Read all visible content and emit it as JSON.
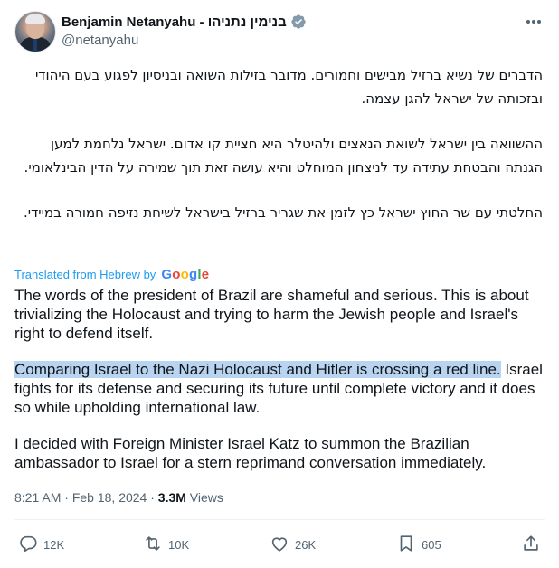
{
  "author": {
    "display_name": "Benjamin Netanyahu - בנימין נתניהו",
    "handle": "@netanyahu",
    "verified_icon": "verified-badge-icon",
    "avatar": "avatar"
  },
  "post": {
    "hebrew_paragraphs": [
      "הדברים של נשיא ברזיל מבישים וחמורים. מדובר בזילות השואה ובניסיון לפגוע בעם היהודי ובזכותה של ישראל להגן עצמה.",
      "ההשוואה בין ישראל לשואת הנאצים ולהיטלר היא חציית קו אדום. ישראל נלחמת למען הגנתה והבטחת עתידה עד לניצחון המוחלט והיא עושה זאת תוך שמירה על הדין הבינלאומי.",
      "החלטתי עם שר החוץ ישראל כץ לזמן את שגריר ברזיל בישראל לשיחת נזיפה חמורה במיידי."
    ],
    "translated_label": "Translated from Hebrew by",
    "translator": "Google",
    "english_paragraph_1": "The words of the president of Brazil are shameful and serious. This is about trivializing the Holocaust and trying to harm the Jewish people and Israel's right to defend itself.",
    "english_paragraph_2_highlighted": "Comparing Israel to the Nazi Holocaust and Hitler is crossing a red line.",
    "english_paragraph_2_rest": " Israel fights for its defense and securing its future until complete victory and it does so while upholding international law.",
    "english_paragraph_3": "I decided with Foreign Minister Israel Katz to summon the Brazilian ambassador to Israel for a stern reprimand conversation immediately."
  },
  "meta": {
    "time": "8:21 AM",
    "separator": " · ",
    "date": "Feb 18, 2024",
    "views_count": "3.3M",
    "views_label": " Views"
  },
  "actions": {
    "reply_count": "12K",
    "repost_count": "10K",
    "like_count": "26K",
    "bookmark_count": "605"
  },
  "colors": {
    "accent": "#1d9bf0",
    "secondary_text": "#536471",
    "highlight": "#b9d4f0"
  }
}
